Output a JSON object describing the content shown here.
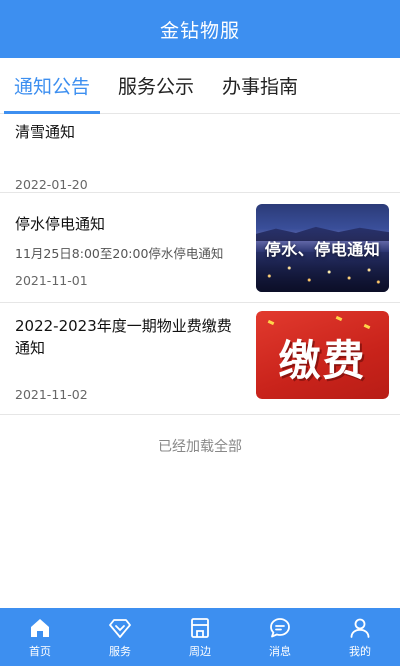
{
  "header": {
    "title": "金钻物服"
  },
  "tabs": [
    {
      "label": "通知公告",
      "active": true
    },
    {
      "label": "服务公示",
      "active": false
    },
    {
      "label": "办事指南",
      "active": false
    }
  ],
  "notices": [
    {
      "title": "清雪通知",
      "date": "2022-01-20"
    },
    {
      "title": "停水停电通知",
      "subtitle": "11月25日8:00至20:00停水停电通知",
      "date": "2021-11-01",
      "image_text": "停水、停电通知"
    },
    {
      "title_line1": "2022-2023年度一期物业费缴费",
      "title_line2": "通知",
      "date": "2021-11-02",
      "image_text": "缴费"
    }
  ],
  "load_all_text": "已经加载全部",
  "bottom_nav": [
    {
      "label": "首页",
      "icon": "home-icon"
    },
    {
      "label": "服务",
      "icon": "diamond-icon"
    },
    {
      "label": "周边",
      "icon": "store-icon"
    },
    {
      "label": "消息",
      "icon": "chat-icon"
    },
    {
      "label": "我的",
      "icon": "user-icon"
    }
  ],
  "colors": {
    "primary": "#3d8ff0",
    "pay_red": "#d42a21"
  }
}
